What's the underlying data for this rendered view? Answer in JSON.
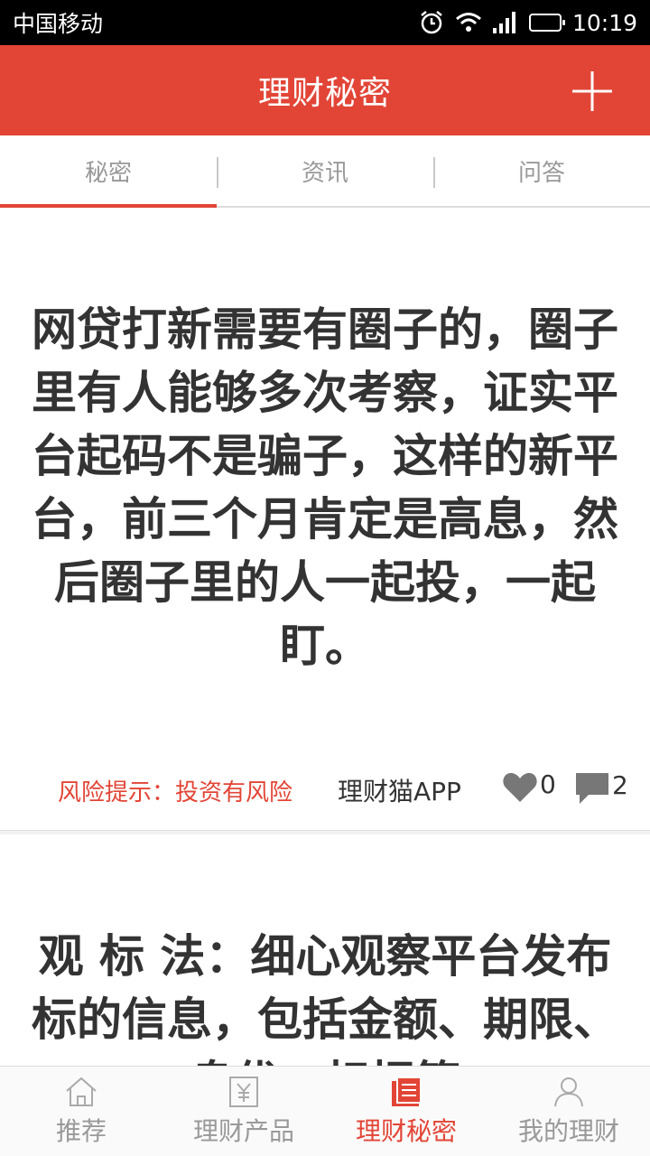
{
  "status": {
    "carrier": "中国移动",
    "time": "10:19"
  },
  "header": {
    "title": "理财秘密"
  },
  "tabs": [
    {
      "label": "秘密",
      "active": true
    },
    {
      "label": "资讯",
      "active": false
    },
    {
      "label": "问答",
      "active": false
    }
  ],
  "cards": [
    {
      "text": "网贷打新需要有圈子的，圈子里有人能够多次考察，证实平台起码不是骗子，这样的新平台，前三个月肯定是高息，然后圈子里的人一起投，一起盯。",
      "risk": "风险提示：投资有风险",
      "source": "理财猫APP",
      "likes": "0",
      "comments": "2"
    },
    {
      "text": "观 标 法：细心观察平台发布标的信息，包括金额、期限、息优、标把等"
    }
  ],
  "bottom_nav": [
    {
      "label": "推荐",
      "icon": "home-icon",
      "active": false
    },
    {
      "label": "理财产品",
      "icon": "yuan-doc-icon",
      "active": false
    },
    {
      "label": "理财秘密",
      "icon": "notebook-icon",
      "active": true
    },
    {
      "label": "我的理财",
      "icon": "person-icon",
      "active": false
    }
  ],
  "colors": {
    "accent": "#e24536",
    "text": "#333333",
    "muted": "#999999"
  }
}
